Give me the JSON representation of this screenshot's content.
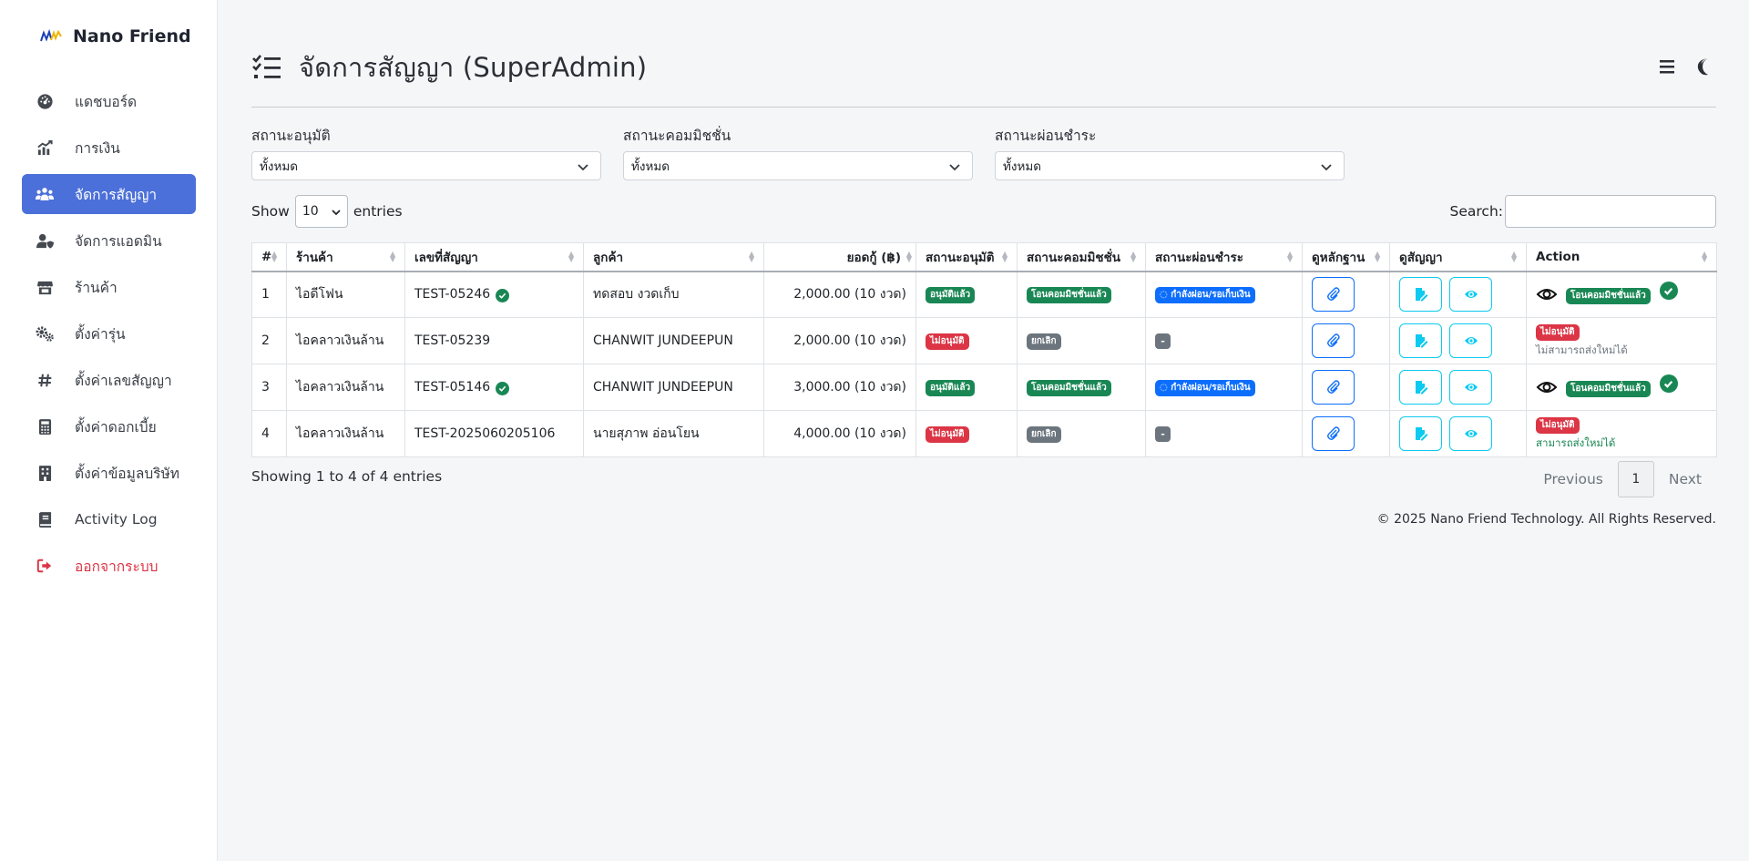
{
  "sidebar": {
    "brand": "Nano Friend",
    "items": [
      {
        "label": "แดชบอร์ด",
        "icon": "gauge-icon"
      },
      {
        "label": "การเงิน",
        "icon": "chart-line-icon"
      },
      {
        "label": "จัดการสัญญา",
        "icon": "users-icon",
        "active": true
      },
      {
        "label": "จัดการแอดมิน",
        "icon": "user-shield-icon"
      },
      {
        "label": "ร้านค้า",
        "icon": "store-icon"
      },
      {
        "label": "ตั้งค่ารุ่น",
        "icon": "gears-icon"
      },
      {
        "label": "ตั้งค่าเลขสัญญา",
        "icon": "hashtag-icon"
      },
      {
        "label": "ตั้งค่าดอกเบี้ย",
        "icon": "calculator-icon"
      },
      {
        "label": "ตั้งค่าข้อมูลบริษัท",
        "icon": "building-icon"
      },
      {
        "label": "Activity Log",
        "icon": "book-icon"
      },
      {
        "label": "ออกจากระบบ",
        "icon": "logout-icon"
      }
    ]
  },
  "header": {
    "title": "จัดการสัญญา (SuperAdmin)"
  },
  "filters": [
    {
      "label": "สถานะอนุมัติ",
      "value": "ทั้งหมด"
    },
    {
      "label": "สถานะคอมมิชชั่น",
      "value": "ทั้งหมด"
    },
    {
      "label": "สถานะผ่อนชำระ",
      "value": "ทั้งหมด"
    }
  ],
  "length": {
    "show": "Show",
    "value": "10",
    "entries": "entries"
  },
  "search": {
    "label": "Search:",
    "value": ""
  },
  "table": {
    "columns": [
      "#",
      "ร้านค้า",
      "เลขที่สัญญา",
      "ลูกค้า",
      "ยอดกู้ (฿)",
      "สถานะอนุมัติ",
      "สถานะคอมมิชชั่น",
      "สถานะผ่อนชำระ",
      "ดูหลักฐาน",
      "ดูสัญญา",
      "Action"
    ],
    "rows": [
      {
        "no": "1",
        "shop": "ไอดีโฟน",
        "contract": "TEST-05246",
        "verified": true,
        "customer": "ทดสอบ งวดเก็บ",
        "amount": "2,000.00 (10 งวด)",
        "approval": "อนุมัติแล้ว",
        "approval_color": "green",
        "commission": "โอนคอมมิชชั่นแล้ว",
        "commission_color": "green",
        "installment": "กำลังผ่อน/รอเก็บเงิน",
        "action_badge": "โอนคอมมิชชั่นแล้ว",
        "action_note": ""
      },
      {
        "no": "2",
        "shop": "ไอคลาวเงินล้าน",
        "contract": "TEST-05239",
        "verified": false,
        "customer": "CHANWIT JUNDEEPUN",
        "amount": "2,000.00 (10 งวด)",
        "approval": "ไม่อนุมัติ",
        "approval_color": "red",
        "commission": "ยกเลิก",
        "commission_color": "gray",
        "installment": "-",
        "action_badge": "ไม่อนุมัติ",
        "action_note": "ไม่สามารถส่งใหม่ได้"
      },
      {
        "no": "3",
        "shop": "ไอคลาวเงินล้าน",
        "contract": "TEST-05146",
        "verified": true,
        "customer": "CHANWIT JUNDEEPUN",
        "amount": "3,000.00 (10 งวด)",
        "approval": "อนุมัติแล้ว",
        "approval_color": "green",
        "commission": "โอนคอมมิชชั่นแล้ว",
        "commission_color": "green",
        "installment": "กำลังผ่อน/รอเก็บเงิน",
        "action_badge": "โอนคอมมิชชั่นแล้ว",
        "action_note": ""
      },
      {
        "no": "4",
        "shop": "ไอคลาวเงินล้าน",
        "contract": "TEST-2025060205106",
        "verified": false,
        "customer": "นายสุภาพ อ่อนโยน",
        "amount": "4,000.00 (10 งวด)",
        "approval": "ไม่อนุมัติ",
        "approval_color": "red",
        "commission": "ยกเลิก",
        "commission_color": "gray",
        "installment": "-",
        "action_badge": "ไม่อนุมัติ",
        "action_note": "สามารถส่งใหม่ได้"
      }
    ]
  },
  "info": "Showing 1 to 4 of 4 entries",
  "pager": {
    "previous": "Previous",
    "current": "1",
    "next": "Next"
  },
  "footer": "© 2025 Nano Friend Technology. All Rights Reserved.",
  "colors": {
    "accent": "#4c70d9",
    "green": "#198754",
    "red": "#dc3545",
    "gray": "#6c757d",
    "blue": "#0d6efd",
    "info": "#0dcaf0"
  }
}
